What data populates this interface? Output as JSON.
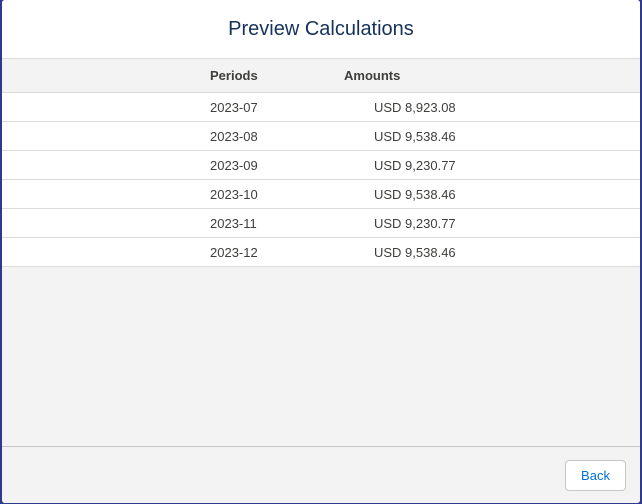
{
  "modal": {
    "title": "Preview Calculations"
  },
  "table": {
    "columns": {
      "periods": "Periods",
      "amounts": "Amounts"
    },
    "rows": [
      {
        "period": "2023-07",
        "amount": "USD 8,923.08"
      },
      {
        "period": "2023-08",
        "amount": "USD 9,538.46"
      },
      {
        "period": "2023-09",
        "amount": "USD 9,230.77"
      },
      {
        "period": "2023-10",
        "amount": "USD 9,538.46"
      },
      {
        "period": "2023-11",
        "amount": "USD 9,230.77"
      },
      {
        "period": "2023-12",
        "amount": "USD 9,538.46"
      }
    ]
  },
  "footer": {
    "back_label": "Back"
  },
  "colors": {
    "accent": "#0070d2",
    "title": "#16325c",
    "backdrop": "#2f3a8c"
  }
}
